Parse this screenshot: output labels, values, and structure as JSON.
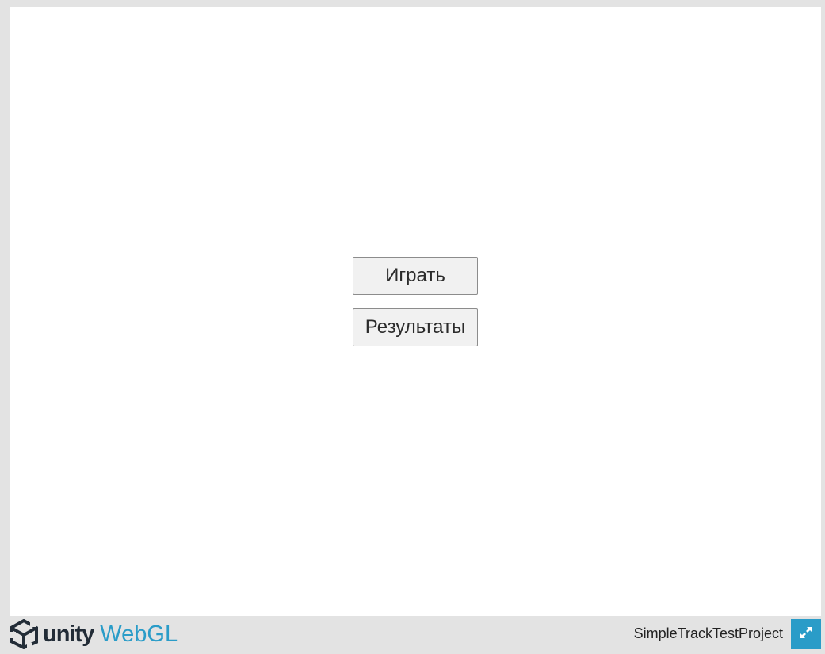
{
  "canvas": {
    "menu": {
      "play_label": "Играть",
      "results_label": "Результаты"
    }
  },
  "footer": {
    "logo_unity": "unity",
    "logo_webgl": "WebGL",
    "title": "SimpleTrackTestProject",
    "icons": {
      "logo": "unity-logo-icon",
      "fullscreen": "fullscreen-icon"
    }
  },
  "colors": {
    "background": "#e3e3e3",
    "canvas": "#ffffff",
    "accent": "#2a9cc8",
    "logo_dark": "#222c37",
    "button_bg": "#f1f1f1",
    "button_border": "#8c8c8c"
  }
}
